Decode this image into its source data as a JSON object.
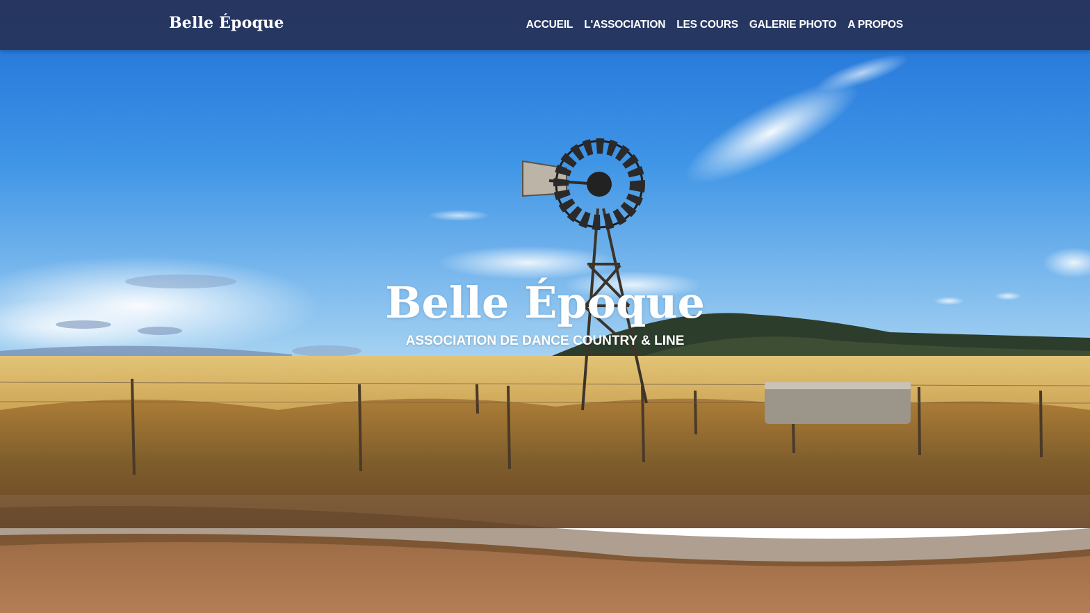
{
  "navbar": {
    "brand": "Belle Époque",
    "links": [
      {
        "label": "ACCUEIL"
      },
      {
        "label": "L'ASSOCIATION"
      },
      {
        "label": "LES COURS"
      },
      {
        "label": "GALERIE PHOTO"
      },
      {
        "label": "A PROPOS"
      }
    ]
  },
  "hero": {
    "title": "Belle Époque",
    "subtitle": "ASSOCIATION DE DANCE COUNTRY & LINE",
    "image_subject": "windmill-in-wheat-field"
  },
  "colors": {
    "navbar_bg": "#26345c",
    "sky_top": "#2a78d8",
    "sky_horizon": "#8fc3ee",
    "field": "#d8b562",
    "ground": "#8a5a34"
  }
}
